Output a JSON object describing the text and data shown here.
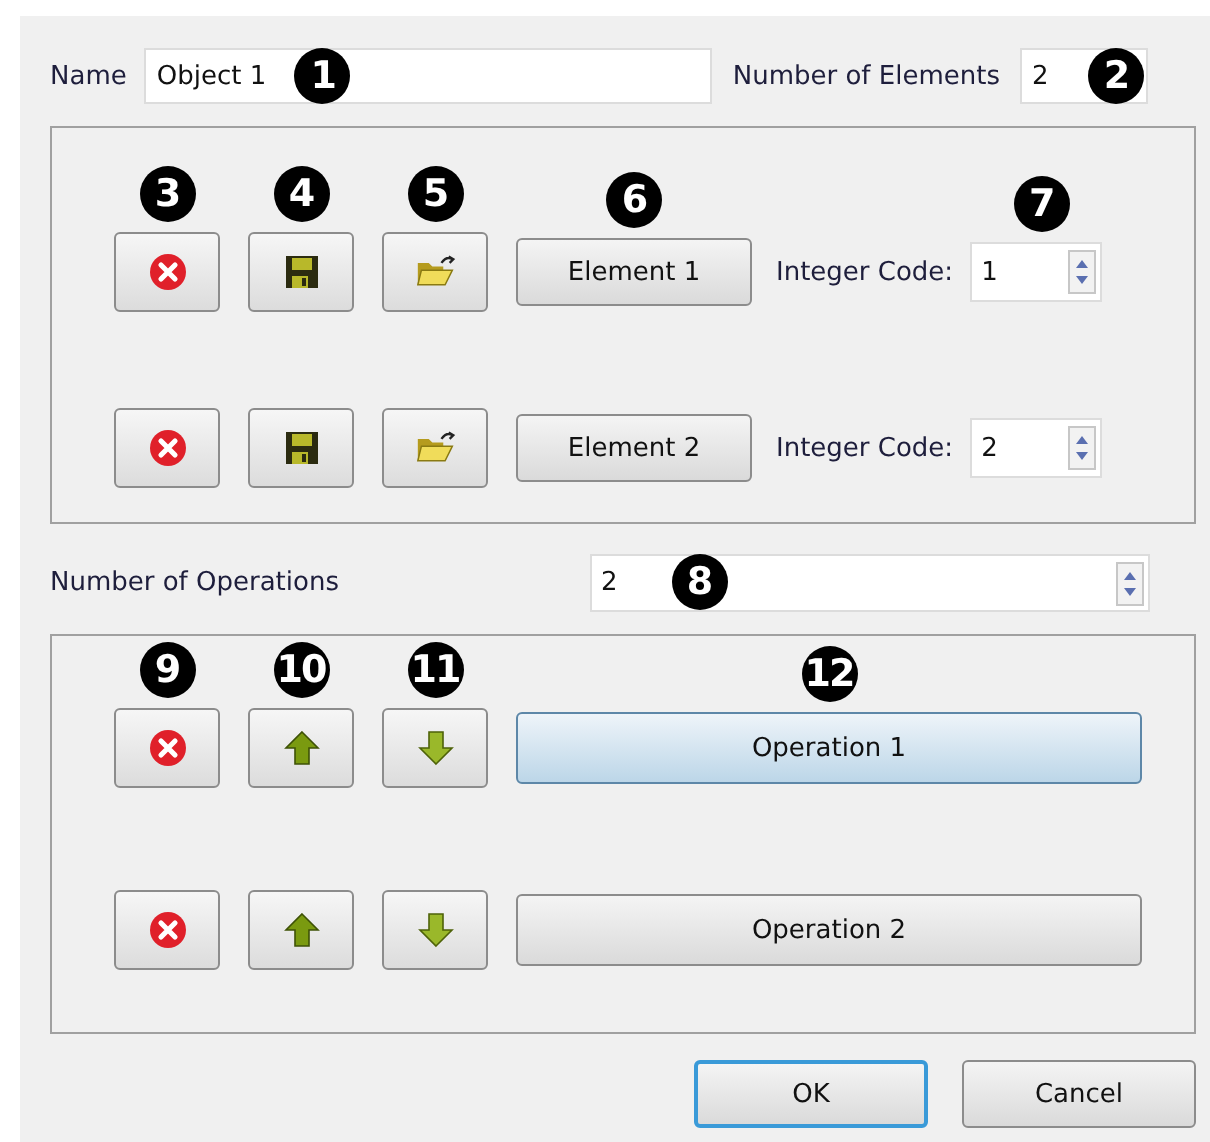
{
  "name": {
    "label": "Name",
    "value": "Object 1",
    "callout": "1"
  },
  "element_count": {
    "label": "Number of Elements",
    "value": "2",
    "callout": "2"
  },
  "elements": [
    {
      "label": "Element 1",
      "code_label": "Integer Code:",
      "code": "1",
      "callouts": {
        "remove": "3",
        "save": "4",
        "open": "5",
        "label": "6",
        "code": "7"
      }
    },
    {
      "label": "Element 2",
      "code_label": "Integer Code:",
      "code": "2"
    }
  ],
  "operation_count": {
    "label": "Number of Operations",
    "value": "2",
    "callout": "8"
  },
  "operations": [
    {
      "label": "Operation 1",
      "selected": true,
      "callouts": {
        "remove": "9",
        "up": "10",
        "down": "11",
        "label": "12"
      }
    },
    {
      "label": "Operation 2",
      "selected": false
    }
  ],
  "buttons": [
    {
      "label": "OK",
      "selected": true
    },
    {
      "label": "Cancel",
      "selected": false
    }
  ]
}
